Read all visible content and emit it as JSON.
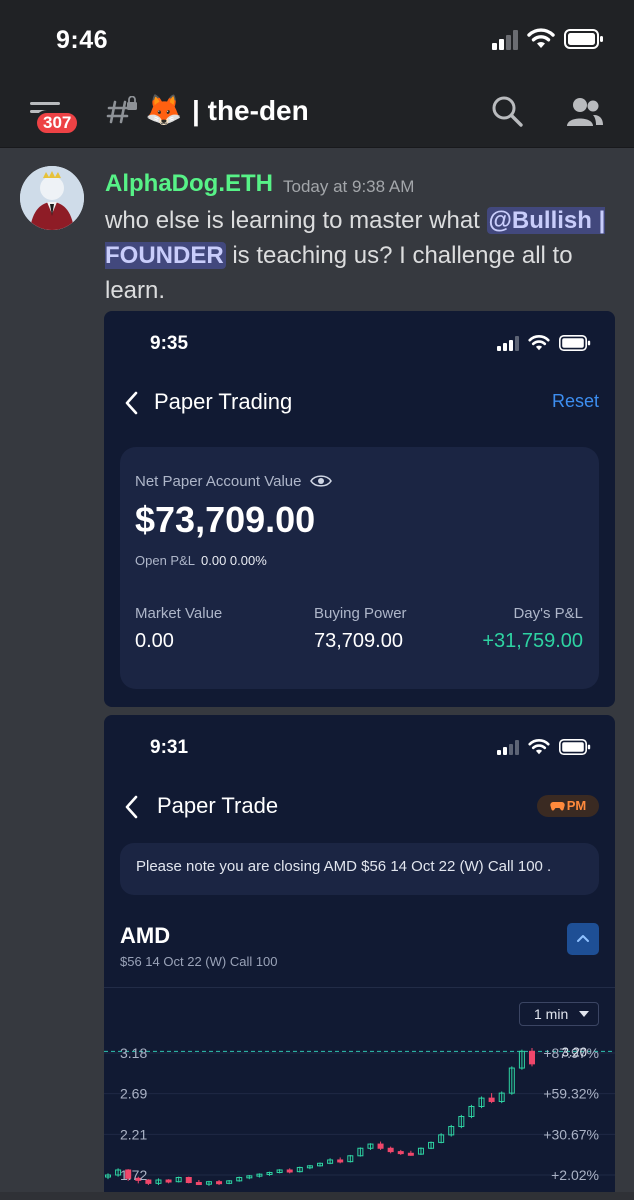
{
  "status_bar": {
    "time": "9:46"
  },
  "header": {
    "unread_count": "307",
    "channel_emoji": "🦊",
    "channel_name": "| the-den"
  },
  "message": {
    "author": "AlphaDog.ETH",
    "timestamp": "Today at 9:38 AM",
    "text_before": "who else is learning to master what ",
    "mention": "@Bullish | FOUNDER",
    "text_after": " is teaching us?  I challenge all to learn."
  },
  "screenshot_1": {
    "time": "9:35",
    "title": "Paper Trading",
    "reset_label": "Reset",
    "account_label": "Net Paper Account Value",
    "account_value": "$73,709.00",
    "open_pl_label": "Open P&L",
    "open_pl_value": "0.00 0.00%",
    "market_value_label": "Market Value",
    "market_value": "0.00",
    "buying_power_label": "Buying Power",
    "buying_power": "73,709.00",
    "days_pl_label": "Day's P&L",
    "days_pl": "+31,759.00"
  },
  "screenshot_2": {
    "time": "9:31",
    "title": "Paper Trade",
    "pm_label": "PM",
    "note": "Please note you are closing AMD $56 14 Oct 22 (W) Call 100 .",
    "symbol": "AMD",
    "contract": "$56 14 Oct 22 (W) Call 100",
    "interval": "1 min"
  },
  "colors": {
    "green": "#2ed3a2",
    "red": "#f0476b",
    "accent": "#3d8ef0",
    "username": "#57f287"
  },
  "chart_data": {
    "type": "candlestick",
    "y_tick_labels": [
      "3.18",
      "2.69",
      "2.21",
      "1.72"
    ],
    "pct_tick_labels": [
      "+87.97%",
      "+59.32%",
      "+30.67%",
      "+2.02%"
    ],
    "current_price": "3.20",
    "ylim": [
      1.7,
      3.3
    ],
    "candles": [
      {
        "o": 1.7,
        "h": 1.74,
        "l": 1.67,
        "c": 1.72
      },
      {
        "o": 1.72,
        "h": 1.8,
        "l": 1.7,
        "c": 1.78
      },
      {
        "o": 1.78,
        "h": 1.79,
        "l": 1.65,
        "c": 1.68
      },
      {
        "o": 1.68,
        "h": 1.7,
        "l": 1.62,
        "c": 1.66
      },
      {
        "o": 1.66,
        "h": 1.67,
        "l": 1.6,
        "c": 1.62
      },
      {
        "o": 1.62,
        "h": 1.68,
        "l": 1.6,
        "c": 1.66
      },
      {
        "o": 1.66,
        "h": 1.67,
        "l": 1.62,
        "c": 1.64
      },
      {
        "o": 1.64,
        "h": 1.7,
        "l": 1.63,
        "c": 1.69
      },
      {
        "o": 1.69,
        "h": 1.7,
        "l": 1.62,
        "c": 1.63
      },
      {
        "o": 1.63,
        "h": 1.66,
        "l": 1.6,
        "c": 1.61
      },
      {
        "o": 1.61,
        "h": 1.65,
        "l": 1.59,
        "c": 1.64
      },
      {
        "o": 1.64,
        "h": 1.66,
        "l": 1.6,
        "c": 1.62
      },
      {
        "o": 1.62,
        "h": 1.66,
        "l": 1.61,
        "c": 1.65
      },
      {
        "o": 1.65,
        "h": 1.7,
        "l": 1.64,
        "c": 1.69
      },
      {
        "o": 1.69,
        "h": 1.72,
        "l": 1.67,
        "c": 1.71
      },
      {
        "o": 1.71,
        "h": 1.74,
        "l": 1.69,
        "c": 1.73
      },
      {
        "o": 1.73,
        "h": 1.76,
        "l": 1.71,
        "c": 1.75
      },
      {
        "o": 1.75,
        "h": 1.79,
        "l": 1.74,
        "c": 1.78
      },
      {
        "o": 1.78,
        "h": 1.8,
        "l": 1.74,
        "c": 1.76
      },
      {
        "o": 1.76,
        "h": 1.82,
        "l": 1.75,
        "c": 1.81
      },
      {
        "o": 1.81,
        "h": 1.84,
        "l": 1.79,
        "c": 1.83
      },
      {
        "o": 1.83,
        "h": 1.87,
        "l": 1.82,
        "c": 1.86
      },
      {
        "o": 1.86,
        "h": 1.92,
        "l": 1.85,
        "c": 1.9
      },
      {
        "o": 1.9,
        "h": 1.93,
        "l": 1.86,
        "c": 1.88
      },
      {
        "o": 1.88,
        "h": 1.96,
        "l": 1.87,
        "c": 1.95
      },
      {
        "o": 1.95,
        "h": 2.05,
        "l": 1.94,
        "c": 2.04
      },
      {
        "o": 2.04,
        "h": 2.1,
        "l": 2.02,
        "c": 2.09
      },
      {
        "o": 2.09,
        "h": 2.12,
        "l": 2.02,
        "c": 2.04
      },
      {
        "o": 2.04,
        "h": 2.06,
        "l": 1.98,
        "c": 2.0
      },
      {
        "o": 2.0,
        "h": 2.02,
        "l": 1.96,
        "c": 1.98
      },
      {
        "o": 1.98,
        "h": 2.01,
        "l": 1.95,
        "c": 1.97
      },
      {
        "o": 1.97,
        "h": 2.05,
        "l": 1.96,
        "c": 2.04
      },
      {
        "o": 2.04,
        "h": 2.12,
        "l": 2.03,
        "c": 2.11
      },
      {
        "o": 2.11,
        "h": 2.22,
        "l": 2.1,
        "c": 2.2
      },
      {
        "o": 2.2,
        "h": 2.32,
        "l": 2.18,
        "c": 2.3
      },
      {
        "o": 2.3,
        "h": 2.44,
        "l": 2.28,
        "c": 2.42
      },
      {
        "o": 2.42,
        "h": 2.56,
        "l": 2.4,
        "c": 2.54
      },
      {
        "o": 2.54,
        "h": 2.66,
        "l": 2.52,
        "c": 2.64
      },
      {
        "o": 2.64,
        "h": 2.7,
        "l": 2.58,
        "c": 2.6
      },
      {
        "o": 2.6,
        "h": 2.72,
        "l": 2.58,
        "c": 2.7
      },
      {
        "o": 2.7,
        "h": 3.02,
        "l": 2.68,
        "c": 3.0
      },
      {
        "o": 3.0,
        "h": 3.22,
        "l": 2.98,
        "c": 3.2
      },
      {
        "o": 3.2,
        "h": 3.24,
        "l": 3.02,
        "c": 3.05
      }
    ]
  }
}
